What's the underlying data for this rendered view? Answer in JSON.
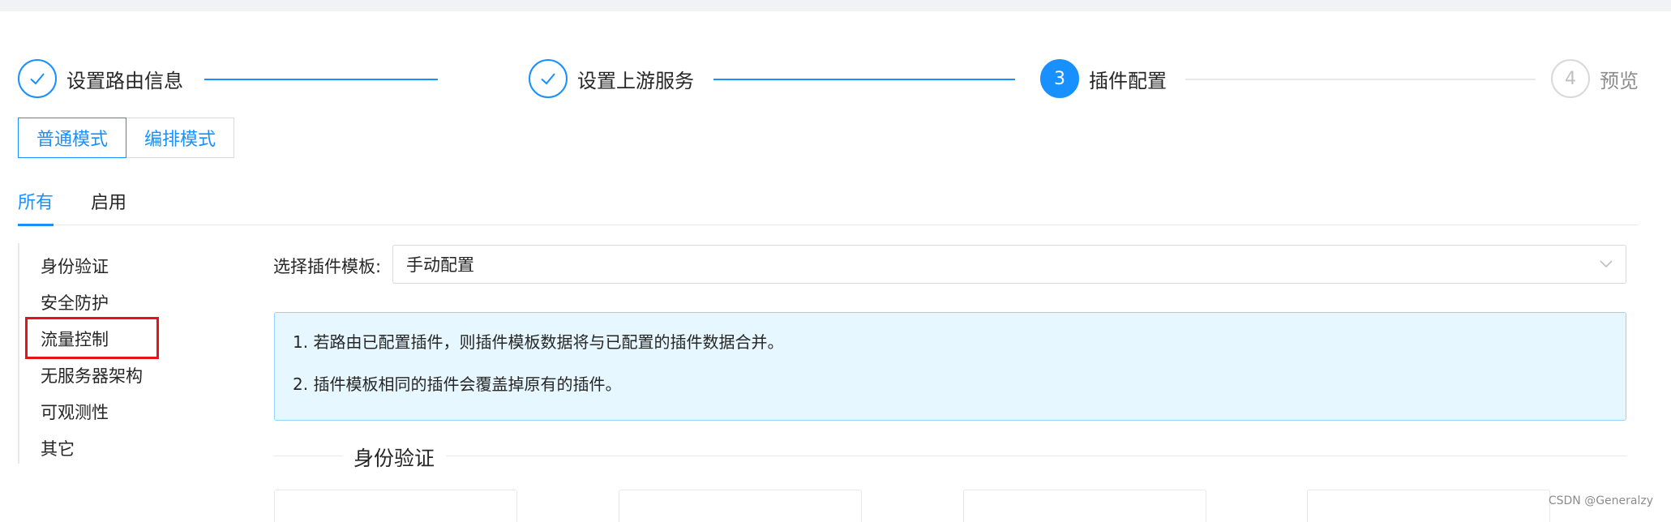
{
  "steps": [
    {
      "title": "设置路由信息",
      "status": "done",
      "icon": "check-icon"
    },
    {
      "title": "设置上游服务",
      "status": "done",
      "icon": "check-icon"
    },
    {
      "number": "3",
      "title": "插件配置",
      "status": "active"
    },
    {
      "number": "4",
      "title": "预览",
      "status": "wait"
    }
  ],
  "modes": {
    "normal_label": "普通模式",
    "orchestration_label": "编排模式",
    "selected": "normal"
  },
  "tabs": {
    "all_label": "所有",
    "enabled_label": "启用",
    "selected": "all"
  },
  "side_menu": {
    "items": [
      "身份验证",
      "安全防护",
      "流量控制",
      "无服务器架构",
      "可观测性",
      "其它"
    ],
    "highlighted": "流量控制"
  },
  "template": {
    "label": "选择插件模板:",
    "value": "手动配置"
  },
  "alert": {
    "line1": "1. 若路由已配置插件，则插件模板数据将与已配置的插件数据合并。",
    "line2": "2. 插件模板相同的插件会覆盖掉原有的插件。"
  },
  "section": {
    "title": "身份验证"
  },
  "watermark": "CSDN @Generalzy",
  "colors": {
    "primary": "#1890ff",
    "highlight": "#e5141b",
    "alert_bg": "#e6f7ff",
    "alert_border": "#91d5ff"
  }
}
